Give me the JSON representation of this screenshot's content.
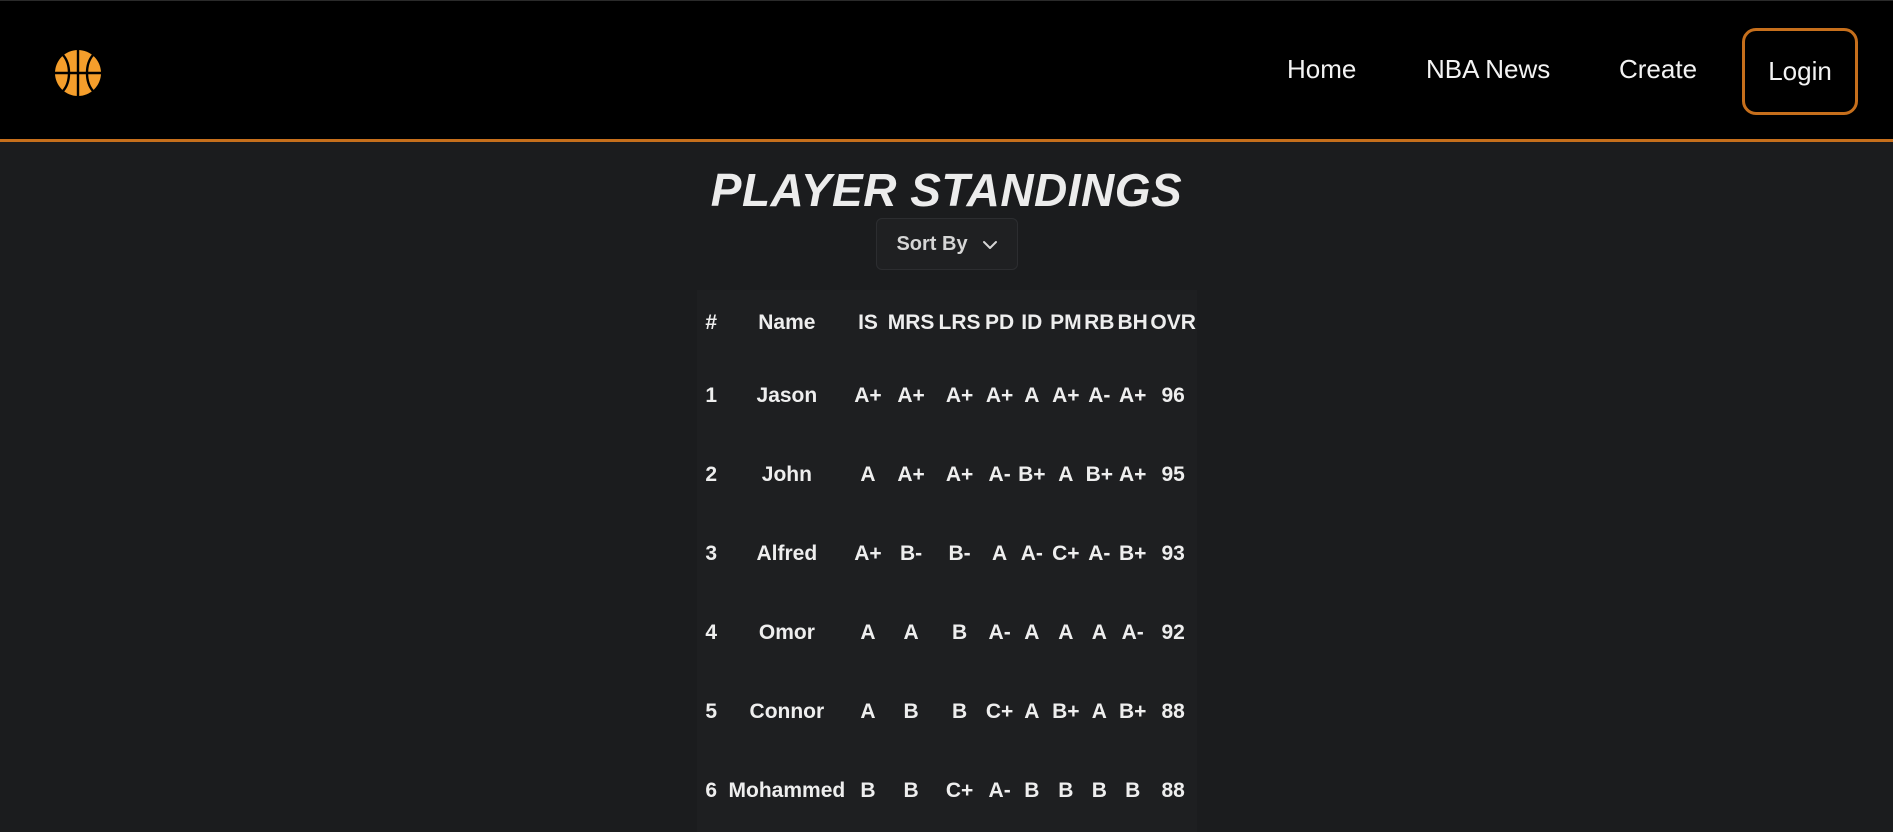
{
  "nav": {
    "logo_icon": "basketball-icon",
    "brand_color": "#f59e2b",
    "links": [
      "Home",
      "NBA News",
      "Create"
    ],
    "login_label": "Login"
  },
  "page": {
    "title": "PLAYER STANDINGS",
    "sort_label": "Sort By"
  },
  "table": {
    "headers": [
      "#",
      "Name",
      "IS",
      "MRS",
      "LRS",
      "PD",
      "ID",
      "PM",
      "RB",
      "BH",
      "OVR"
    ],
    "rows": [
      [
        "1",
        "Jason",
        "A+",
        "A+",
        "A+",
        "A+",
        "A",
        "A+",
        "A-",
        "A+",
        "96"
      ],
      [
        "2",
        "John",
        "A",
        "A+",
        "A+",
        "A-",
        "B+",
        "A",
        "B+",
        "A+",
        "95"
      ],
      [
        "3",
        "Alfred",
        "A+",
        "B-",
        "B-",
        "A",
        "A-",
        "C+",
        "A-",
        "B+",
        "93"
      ],
      [
        "4",
        "Omor",
        "A",
        "A",
        "B",
        "A-",
        "A",
        "A",
        "A",
        "A-",
        "92"
      ],
      [
        "5",
        "Connor",
        "A",
        "B",
        "B",
        "C+",
        "A",
        "B+",
        "A",
        "B+",
        "88"
      ],
      [
        "6",
        "Mohammed",
        "B",
        "B",
        "C+",
        "A-",
        "B",
        "B",
        "B",
        "B",
        "88"
      ]
    ]
  }
}
